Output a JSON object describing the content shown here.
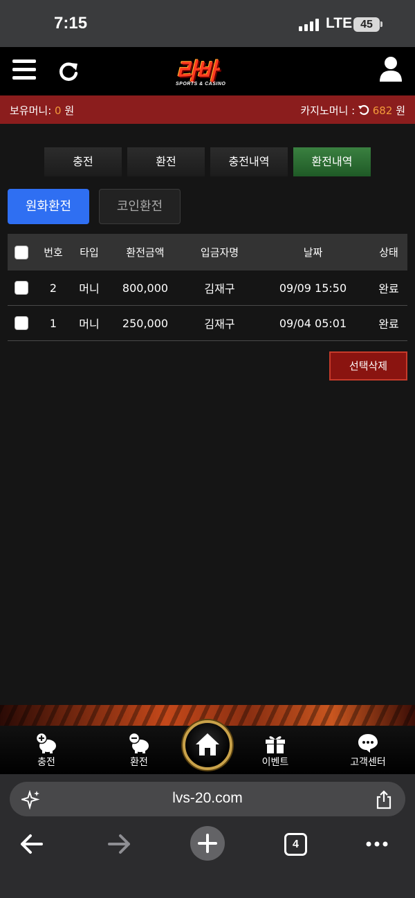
{
  "status_bar": {
    "time": "7:15",
    "network": "LTE",
    "battery": "45"
  },
  "site": {
    "logo_text": "라바",
    "logo_sub": "SPORTS & CASINO"
  },
  "money": {
    "holding_label": "보유머니:",
    "holding_value": "0",
    "holding_unit": "원",
    "casino_label": "카지노머니 :",
    "casino_value": "682",
    "casino_unit": "원"
  },
  "tabs": [
    {
      "label": "충전",
      "active": false
    },
    {
      "label": "환전",
      "active": false
    },
    {
      "label": "충전내역",
      "active": false
    },
    {
      "label": "환전내역",
      "active": true
    }
  ],
  "subtabs": {
    "won": "원화환전",
    "coin": "코인환전"
  },
  "table": {
    "headers": {
      "no": "번호",
      "type": "타입",
      "amount": "환전금액",
      "depositor": "입금자명",
      "date": "날짜",
      "status": "상태"
    },
    "rows": [
      {
        "no": "2",
        "type": "머니",
        "amount": "800,000",
        "depositor": "김재구",
        "date": "09/09 15:50",
        "status": "완료"
      },
      {
        "no": "1",
        "type": "머니",
        "amount": "250,000",
        "depositor": "김재구",
        "date": "09/04 05:01",
        "status": "완료"
      }
    ]
  },
  "delete_selected": "선택삭제",
  "bottom_nav": {
    "charge": "충전",
    "exchange": "환전",
    "event": "이벤트",
    "support": "고객센터"
  },
  "browser": {
    "url": "lvs-20.com",
    "tab_count": "4"
  },
  "colors": {
    "money_bar": "#8b1d1d",
    "active_tab": "#2f7a37",
    "primary_button": "#2f6ff2",
    "highlight": "#f39b3a",
    "delete_button": "#8a1410"
  }
}
